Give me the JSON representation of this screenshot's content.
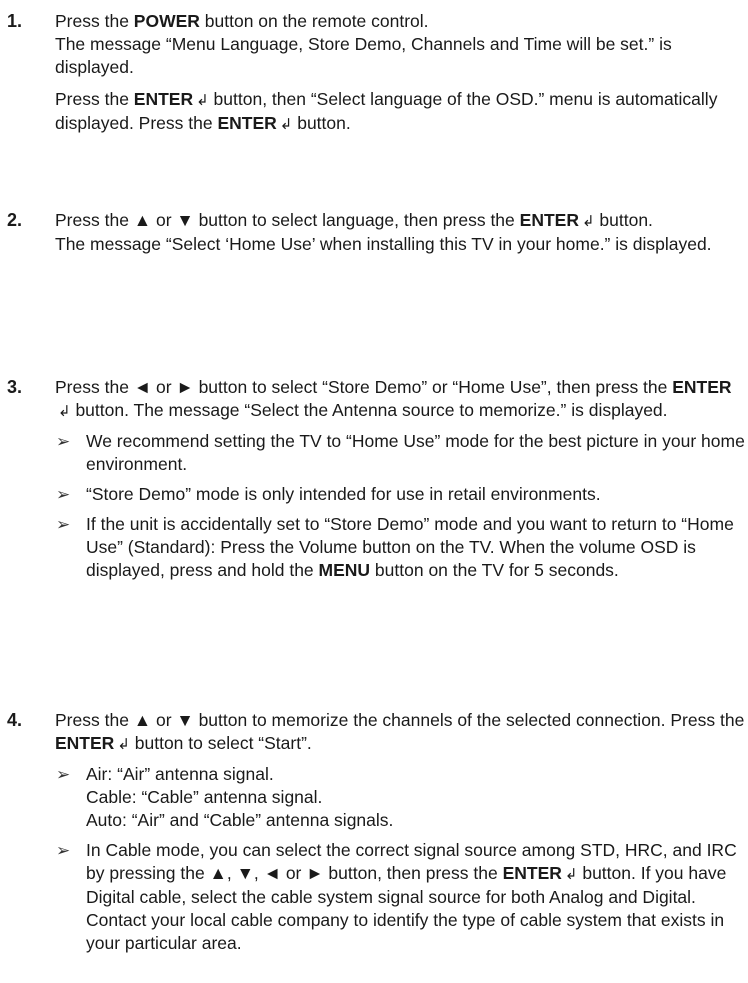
{
  "steps": [
    {
      "number": "1.",
      "lines": [
        "Press the ",
        "POWER",
        " button on the remote control.",
        "The message “Menu Language, Store Demo, Channels and Time will be set.” is displayed.",
        "Press the ",
        "ENTER",
        " button, then “Select language of the OSD.” menu is automatically displayed. Press the ",
        "ENTER",
        " button."
      ]
    },
    {
      "number": "2.",
      "lines": [
        "Press the ▲ or ▼ button to select language, then press the ",
        "ENTER",
        " button.",
        "The message “Select ‘Home Use’ when installing this TV in your home.” is displayed."
      ]
    },
    {
      "number": "3.",
      "lines": [
        "Press the ◄ or ► button to select “Store Demo” or “Home Use”, then press the ",
        "ENTER",
        " button. The message “Select the Antenna source to memorize.” is displayed."
      ],
      "notes": [
        "We recommend setting the TV to “Home Use” mode for the best picture in your home environment.",
        "“Store Demo” mode is only intended for use in retail environments.",
        "If the unit is accidentally set to “Store Demo” mode and you want to return to “Home Use” (Standard): Press the Volume button on the TV. When the volume OSD is displayed, press and hold the ",
        "MENU",
        " button on the TV for 5 seconds."
      ]
    },
    {
      "number": "4.",
      "lines": [
        "Press the ▲ or ▼ button to memorize the channels of the selected connection. Press the ",
        "ENTER",
        " button to select “Start”."
      ],
      "notes": [
        "Air: “Air” antenna signal.",
        "Cable: “Cable” antenna signal.",
        "Auto: “Air” and “Cable” antenna signals.",
        "In Cable mode, you can select the correct signal source among STD, HRC, and IRC by pressing the ▲, ▼, ◄ or ► button, then press the ",
        "ENTER",
        " button. If you have Digital cable, select the cable system signal source for both Analog and Digital. Contact your local cable company to identify the type of cable system that exists in your particular area."
      ]
    }
  ],
  "icons": {
    "enter": "enter-icon",
    "note": "note-arrow-icon"
  },
  "glyphs": {
    "enter": "↲",
    "note_arrow": "➢"
  }
}
